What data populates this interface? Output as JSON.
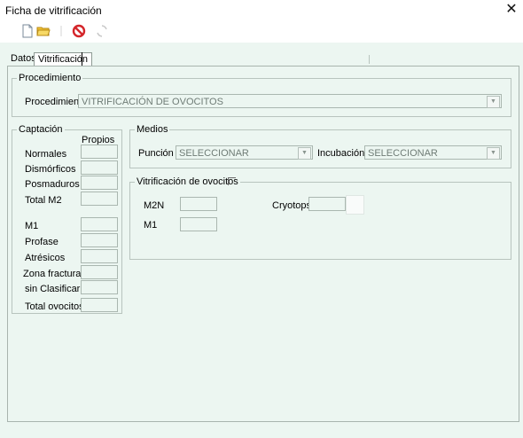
{
  "window": {
    "title": "Ficha de vitrificación",
    "close_glyph": "✕"
  },
  "toolbar": {
    "icons": [
      "new-document-icon",
      "open-folder-icon",
      "separator",
      "cancel-icon",
      "refresh-icon"
    ]
  },
  "tabs": [
    {
      "label": "Datos"
    },
    {
      "label": "Vitrificación"
    }
  ],
  "procedimiento": {
    "legend": "Procedimiento",
    "label": "Procedimiento",
    "value": "VITRIFICACIÓN DE OVOCITOS"
  },
  "captacion": {
    "legend": "Captación",
    "column_header": "Propios",
    "rows": [
      "Normales",
      "Dismórficos",
      "Posmaduros",
      "Total M2",
      "M1",
      "Profase",
      "Atrésicos",
      "Zona fracturada",
      "sin Clasificar",
      "Total ovocitos"
    ]
  },
  "medios": {
    "legend": "Medios",
    "puncion_label": "Punción",
    "puncion_value": "SELECCIONAR",
    "incubacion_label": "Incubación",
    "incubacion_value": "SELECCIONAR"
  },
  "vitrificacion": {
    "legend": "Vitrificación de ovocitos",
    "m2n_label": "M2N",
    "m1_label": "M1",
    "cryotops_label": "Cryotops"
  },
  "colors": {
    "client_bg": "#ecf6f1",
    "border": "#aab7b0",
    "cancel_red": "#d4252a",
    "folder_yellow": "#f2c233"
  }
}
